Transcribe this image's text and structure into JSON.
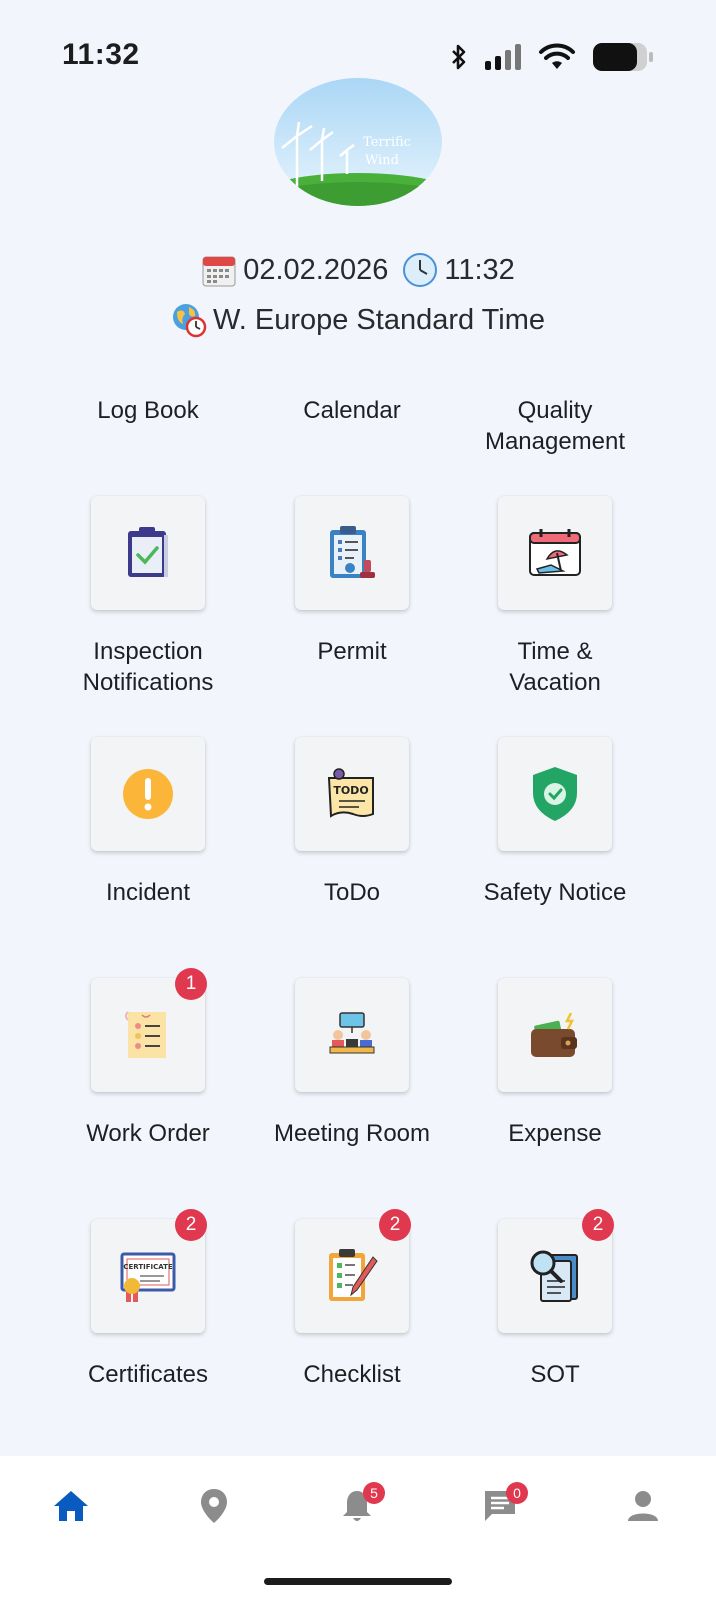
{
  "status_bar": {
    "time": "11:32"
  },
  "logo": {
    "text_line1": "Terrific",
    "text_line2": "Wind"
  },
  "header": {
    "date": "02.02.2026",
    "time": "11:32",
    "timezone": "W. Europe Standard Time"
  },
  "tiles": [
    {
      "label": "Log Book",
      "icon": "clipboard-check-icon",
      "badge": null
    },
    {
      "label": "Calendar",
      "icon": "permit-clipboard-icon",
      "badge": null
    },
    {
      "label": "Quality Management",
      "icon": "vacation-calendar-icon",
      "badge": null
    },
    {
      "label": "Inspection Notifications",
      "icon": "alert-icon",
      "badge": null
    },
    {
      "label": "Permit",
      "icon": "todo-note-icon",
      "badge": null
    },
    {
      "label": "Time & Vacation",
      "icon": "shield-check-icon",
      "badge": null
    },
    {
      "label": "Incident",
      "icon": "document-list-icon",
      "badge": "1"
    },
    {
      "label": "ToDo",
      "icon": "meeting-icon",
      "badge": null
    },
    {
      "label": "Safety Notice",
      "icon": "wallet-icon",
      "badge": null
    },
    {
      "label": "Work Order",
      "icon": "certificate-icon",
      "badge": "2"
    },
    {
      "label": "Meeting Room",
      "icon": "checklist-icon",
      "badge": "2"
    },
    {
      "label": "Expense",
      "icon": "search-document-icon",
      "badge": "2"
    },
    {
      "label": "Certificates",
      "icon": null,
      "badge": null
    },
    {
      "label": "Checklist",
      "icon": null,
      "badge": null
    },
    {
      "label": "SOT",
      "icon": null,
      "badge": null
    }
  ],
  "bottom_nav": {
    "items": [
      {
        "name": "home",
        "icon": "home-icon",
        "badge": null
      },
      {
        "name": "location",
        "icon": "location-pin-icon",
        "badge": null
      },
      {
        "name": "notifications",
        "icon": "bell-icon",
        "badge": "5"
      },
      {
        "name": "messages",
        "icon": "chat-icon",
        "badge": "0"
      },
      {
        "name": "profile",
        "icon": "person-icon",
        "badge": null
      }
    ],
    "active_color": "#0a5bbf",
    "inactive_color": "#8c8c8c"
  },
  "colors": {
    "background": "#f2f6fc",
    "badge": "#e0384e"
  }
}
